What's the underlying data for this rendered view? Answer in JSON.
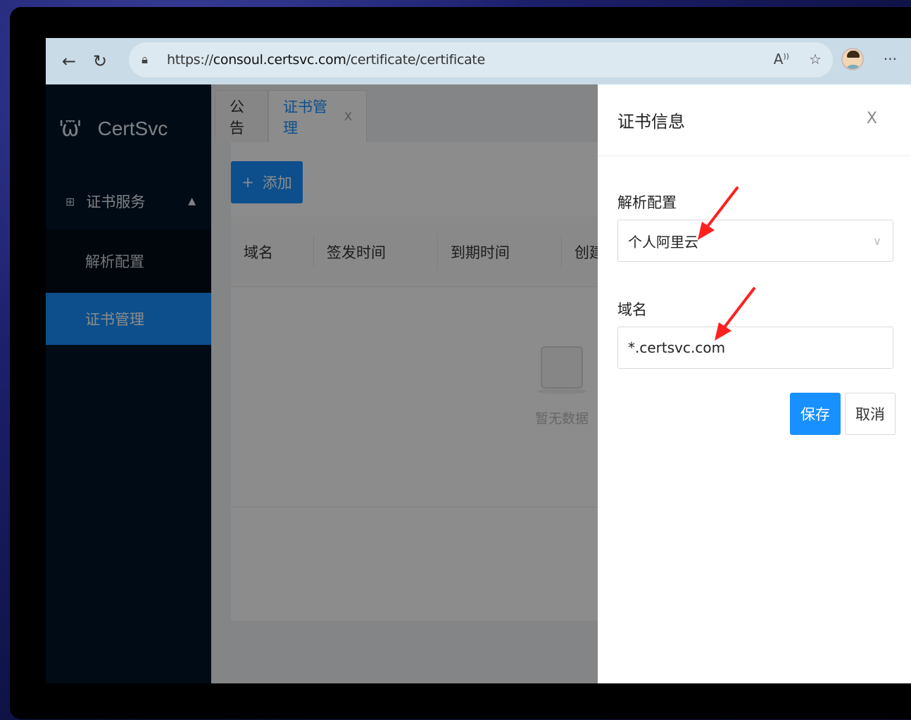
{
  "browser": {
    "url_prefix": "https://",
    "url_host": "consoul.certsvc.com",
    "url_path": "/certificate/certificate"
  },
  "sidebar": {
    "logo_text": "CertSvc",
    "group_label": "证书服务",
    "items": [
      {
        "label": "解析配置"
      },
      {
        "label": "证书管理"
      }
    ]
  },
  "tabs": [
    {
      "label": "公告"
    },
    {
      "label": "证书管理",
      "close": "X"
    }
  ],
  "toolbar": {
    "add_label": "添加"
  },
  "table": {
    "columns": [
      "域名",
      "签发时间",
      "到期时间",
      "创建"
    ],
    "empty_text": "暂无数据"
  },
  "drawer": {
    "title": "证书信息",
    "close": "X",
    "fields": [
      {
        "label": "解析配置",
        "value": "个人阿里云"
      },
      {
        "label": "域名",
        "value": "*.certsvc.com"
      }
    ],
    "save_label": "保存",
    "cancel_label": "取消"
  },
  "colors": {
    "primary": "#1890ff",
    "sidebar_bg": "#001529",
    "annotation_arrow": "#ff2020"
  }
}
